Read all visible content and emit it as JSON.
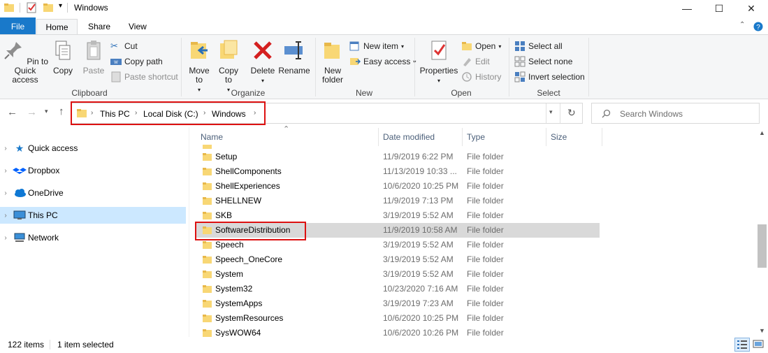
{
  "window": {
    "title": "Windows"
  },
  "tabs": [
    {
      "label": "File"
    },
    {
      "label": "Home"
    },
    {
      "label": "Share"
    },
    {
      "label": "View"
    }
  ],
  "ribbon": {
    "clipboard": {
      "label": "Clipboard",
      "pin": "Pin to Quick access",
      "copy": "Copy",
      "paste": "Paste",
      "cut": "Cut",
      "copy_path": "Copy path",
      "paste_shortcut": "Paste shortcut"
    },
    "organize": {
      "label": "Organize",
      "move_to": "Move to",
      "copy_to": "Copy to",
      "delete": "Delete",
      "rename": "Rename"
    },
    "new": {
      "label": "New",
      "new_folder": "New folder",
      "new_item": "New item",
      "easy_access": "Easy access"
    },
    "open": {
      "label": "Open",
      "properties": "Properties",
      "open": "Open",
      "edit": "Edit",
      "history": "History"
    },
    "select": {
      "label": "Select",
      "select_all": "Select all",
      "select_none": "Select none",
      "invert_selection": "Invert selection"
    }
  },
  "address": {
    "crumbs": [
      "This PC",
      "Local Disk (C:)",
      "Windows"
    ],
    "search_placeholder": "Search Windows"
  },
  "nav": [
    {
      "label": "Quick access"
    },
    {
      "label": "Dropbox"
    },
    {
      "label": "OneDrive"
    },
    {
      "label": "This PC"
    },
    {
      "label": "Network"
    }
  ],
  "columns": {
    "name": "Name",
    "date": "Date modified",
    "type": "Type",
    "size": "Size"
  },
  "files": [
    {
      "name": "Setup",
      "date": "11/9/2019 6:22 PM",
      "type": "File folder"
    },
    {
      "name": "ShellComponents",
      "date": "11/13/2019 10:33 ...",
      "type": "File folder"
    },
    {
      "name": "ShellExperiences",
      "date": "10/6/2020 10:25 PM",
      "type": "File folder"
    },
    {
      "name": "SHELLNEW",
      "date": "11/9/2019 7:13 PM",
      "type": "File folder"
    },
    {
      "name": "SKB",
      "date": "3/19/2019 5:52 AM",
      "type": "File folder"
    },
    {
      "name": "SoftwareDistribution",
      "date": "11/9/2019 10:58 AM",
      "type": "File folder"
    },
    {
      "name": "Speech",
      "date": "3/19/2019 5:52 AM",
      "type": "File folder"
    },
    {
      "name": "Speech_OneCore",
      "date": "3/19/2019 5:52 AM",
      "type": "File folder"
    },
    {
      "name": "System",
      "date": "3/19/2019 5:52 AM",
      "type": "File folder"
    },
    {
      "name": "System32",
      "date": "10/23/2020 7:16 AM",
      "type": "File folder"
    },
    {
      "name": "SystemApps",
      "date": "3/19/2019 7:23 AM",
      "type": "File folder"
    },
    {
      "name": "SystemResources",
      "date": "10/6/2020 10:25 PM",
      "type": "File folder"
    },
    {
      "name": "SysWOW64",
      "date": "10/6/2020 10:26 PM",
      "type": "File folder"
    }
  ],
  "status": {
    "items": "122 items",
    "selected": "1 item selected"
  },
  "colors": {
    "accent": "#1979ca",
    "highlight": "#d11111",
    "selection": "#cce8ff",
    "folder": "#f8d775"
  }
}
